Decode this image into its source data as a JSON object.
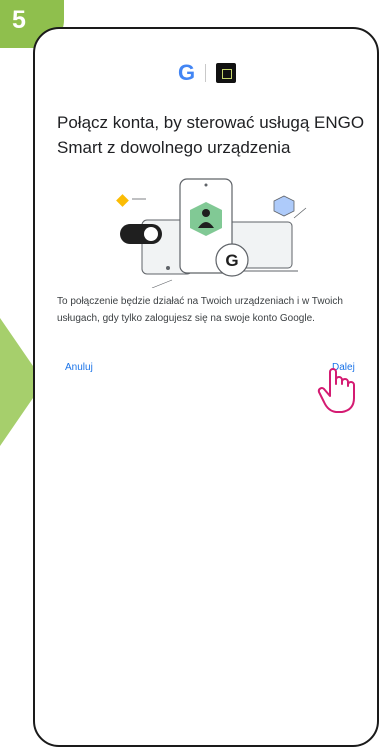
{
  "step": {
    "number": "5"
  },
  "header": {
    "google_logo": "G",
    "app_logo_icon": "engo-logo-icon"
  },
  "dialog": {
    "title": "Połącz konta, by sterować usługą ENGO Smart z dowolnego urządzenia",
    "description": "To połączenie będzie działać na Twoich urządzeniach i w Twoich usługach, gdy tylko zalogujesz się na swoje konto Google.",
    "cancel_label": "Anuluj",
    "next_label": "Dalej"
  },
  "colors": {
    "step_badge": "#8fbf4d",
    "link": "#1a73e8",
    "hand_pointer": "#d41b72"
  }
}
